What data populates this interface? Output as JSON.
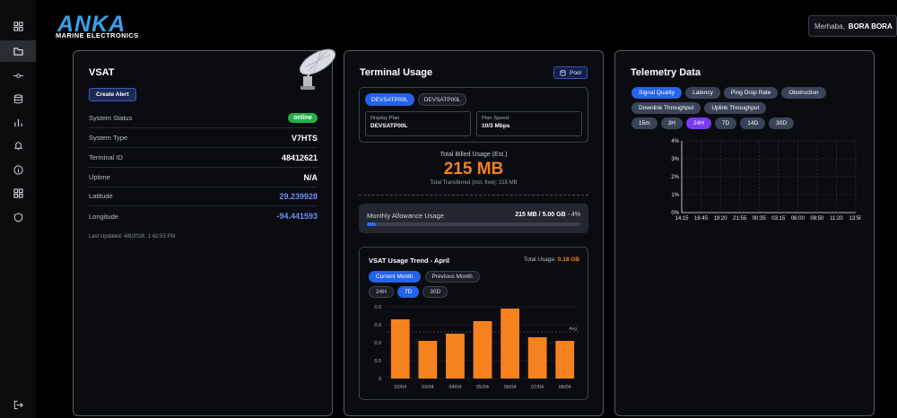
{
  "brand": {
    "logo_text": "ANKA",
    "logo_subtitle": "MARINE ELECTRONICS"
  },
  "user": {
    "greeting": "Merhaba,",
    "name": "BORA BORA"
  },
  "sidebar": {
    "items": [
      {
        "icon": "grid-icon",
        "active": false
      },
      {
        "icon": "folder-icon",
        "active": true
      },
      {
        "icon": "route-icon",
        "active": false
      },
      {
        "icon": "database-icon",
        "active": false
      },
      {
        "icon": "bar-chart-icon",
        "active": false
      },
      {
        "icon": "bell-icon",
        "active": false
      },
      {
        "icon": "info-icon",
        "active": false
      },
      {
        "icon": "apps-icon",
        "active": false
      },
      {
        "icon": "shield-icon",
        "active": false
      }
    ],
    "logout_icon": "logout-icon"
  },
  "vsat": {
    "title": "VSAT",
    "create_alert": "Create Alert",
    "rows": [
      {
        "key": "System Status",
        "value": "online",
        "type": "badge"
      },
      {
        "key": "System Type",
        "value": "V7HTS",
        "type": "text"
      },
      {
        "key": "Terminal ID",
        "value": "48412621",
        "type": "text"
      },
      {
        "key": "Uptime",
        "value": "N/A",
        "type": "text"
      },
      {
        "key": "Latitude",
        "value": "29.239928",
        "type": "blue"
      },
      {
        "key": "Longitude",
        "value": "-94.441593",
        "type": "blue"
      }
    ],
    "last_updated": "Last Updated: 4/8/2026, 1:42:53 PM"
  },
  "terminal": {
    "title": "Terminal Usage",
    "pool_label": "Pool",
    "tabs": [
      "DEVSATP00L",
      "DEVSATP00L"
    ],
    "active_tab": 0,
    "display_plan_label": "Display Plan",
    "display_plan_value": "DEVSATP00L",
    "plan_speed_label": "Plan Speed",
    "plan_speed_value": "10/3 Mbps",
    "billed_label": "Total Billed Usage (Est.)",
    "billed_value": "215 MB",
    "billed_sub": "Total Transferred (incl. free): 215 MB",
    "allowance_label": "Monthly Allowance Usage",
    "allowance_value": "215 MB / 5.00 GB",
    "allowance_pct_text": "- 4%",
    "allowance_fraction": 0.043,
    "trend": {
      "title": "VSAT Usage Trend - April",
      "total_label": "Total Usage:",
      "total_value": "0.18 GB",
      "period_tabs": [
        "Current Month",
        "Previous Month"
      ],
      "active_period": 0,
      "range_tabs": [
        "24H",
        "7D",
        "30D"
      ],
      "active_range": 1
    }
  },
  "telemetry": {
    "title": "Telemetry Data",
    "metric_tabs_row1": [
      "Signal Quality",
      "Latency",
      "Ping Drop Rate",
      "Obstruction"
    ],
    "metric_tabs_row2": [
      "Downlink Throughput",
      "Uplink Throughput"
    ],
    "active_metric": 0,
    "range_tabs": [
      "15m",
      "3H",
      "24H",
      "7D",
      "14D",
      "30D"
    ],
    "active_range": 2
  },
  "chart_data": [
    {
      "type": "bar",
      "categories": [
        "02/04",
        "03/04",
        "04/04",
        "05/04",
        "06/04",
        "07/04",
        "08/04"
      ],
      "values": [
        0.033,
        0.021,
        0.025,
        0.032,
        0.039,
        0.023,
        0.021
      ],
      "yticks": [
        "0.0",
        "0.0",
        "0.0",
        "0.0",
        "0"
      ],
      "ylim": [
        0,
        0.04
      ],
      "avg_label": "Avg",
      "avg_value": 0.026,
      "color": "#f5821f"
    },
    {
      "type": "line",
      "x": [
        "14:15",
        "16:45",
        "19:20",
        "21:55",
        "00:35",
        "03:15",
        "06:00",
        "08:50",
        "11:20",
        "13:50"
      ],
      "yticks": [
        "0%",
        "1%",
        "2%",
        "3%",
        "4%"
      ],
      "ylim": [
        0,
        4
      ],
      "series": [],
      "grid": true
    }
  ]
}
